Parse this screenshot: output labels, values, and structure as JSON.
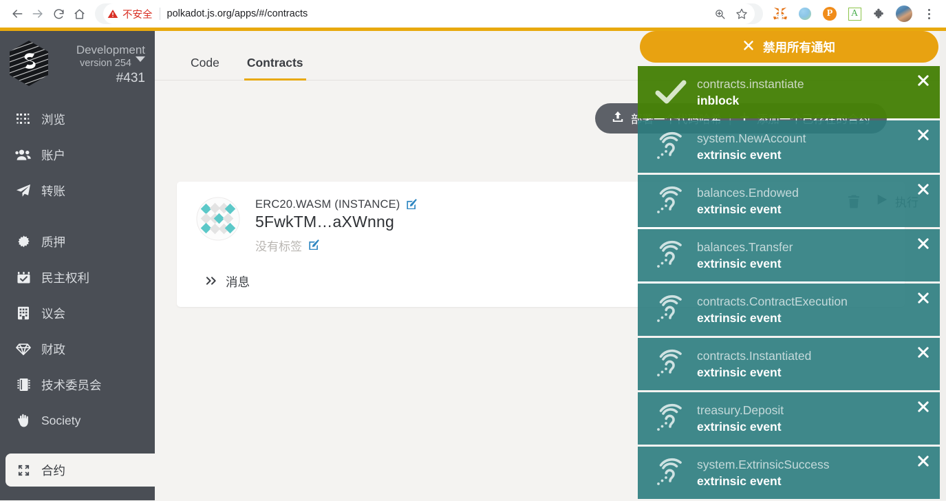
{
  "browser": {
    "back_icon": "back-arrow-icon",
    "forward_icon": "forward-arrow-icon",
    "reload_icon": "reload-icon",
    "home_icon": "home-icon",
    "security_label": "不安全",
    "url": "polkadot.js.org/apps/#/contracts",
    "zoom_icon": "zoom-icon",
    "bookmark_icon": "star-icon",
    "extensions": [
      {
        "name": "metamask-icon",
        "label": ""
      },
      {
        "name": "wallet-circle-icon",
        "label": ""
      },
      {
        "name": "polkadot-extension-icon",
        "label": "P"
      },
      {
        "name": "grammarly-icon",
        "label": "A"
      },
      {
        "name": "puzzle-extensions-icon",
        "label": ""
      },
      {
        "name": "profile-avatar",
        "label": ""
      }
    ],
    "menu_icon": "kebab-menu-icon"
  },
  "sidebar": {
    "brand": {
      "logo_icon": "substrate-hexagon-logo",
      "title": "Development",
      "version": "version 254",
      "block": "#431",
      "caret_icon": "chevron-down-icon"
    },
    "items": [
      {
        "label": "浏览",
        "icon": "grid-dots-icon",
        "active": false,
        "gap": false
      },
      {
        "label": "账户",
        "icon": "users-icon",
        "active": false,
        "gap": false
      },
      {
        "label": "转账",
        "icon": "paper-plane-icon",
        "active": false,
        "gap": false
      },
      {
        "label": "质押",
        "icon": "gear-sun-icon",
        "active": false,
        "gap": true
      },
      {
        "label": "民主权利",
        "icon": "calendar-check-icon",
        "active": false,
        "gap": false
      },
      {
        "label": "议会",
        "icon": "building-icon",
        "active": false,
        "gap": false
      },
      {
        "label": "财政",
        "icon": "gem-icon",
        "active": false,
        "gap": false
      },
      {
        "label": "技术委员会",
        "icon": "memory-chip-icon",
        "active": false,
        "gap": false
      },
      {
        "label": "Society",
        "icon": "hand-icon",
        "active": false,
        "gap": false
      },
      {
        "label": "合约",
        "icon": "expand-arrows-icon",
        "active": true,
        "gap": true
      }
    ]
  },
  "main": {
    "tabs": [
      {
        "label": "Code",
        "active": false
      },
      {
        "label": "Contracts",
        "active": true
      }
    ],
    "actions": {
      "deploy_icon": "upload-icon",
      "deploy_label": "部署一个代码哈希",
      "separator": "|",
      "add_icon": "plus-icon",
      "add_label": "添加一个已存在的合约"
    },
    "contract": {
      "identicon": "polkadot-identicon",
      "name": "ERC20.WASM (INSTANCE)",
      "name_edit_icon": "edit-pencil-icon",
      "address": "5FwkTM…aXWnng",
      "tag_placeholder": "没有标签",
      "tag_edit_icon": "edit-pencil-icon",
      "messages_chevron_icon": "double-chevron-right-icon",
      "messages_label": "消息",
      "delete_icon": "trash-icon",
      "execute_icon": "play-icon",
      "execute_label": "执行"
    }
  },
  "notifications": {
    "disable_all": {
      "close_icon": "close-x-icon",
      "label": "禁用所有通知"
    },
    "items": [
      {
        "title": "contracts.instantiate",
        "subtitle": "inblock",
        "status": "success",
        "icon": "check-mark-icon",
        "close_icon": "close-x-icon"
      },
      {
        "title": "system.NewAccount",
        "subtitle": "extrinsic event",
        "status": "event",
        "icon": "broadcast-ear-icon",
        "close_icon": "close-x-icon"
      },
      {
        "title": "balances.Endowed",
        "subtitle": "extrinsic event",
        "status": "event",
        "icon": "broadcast-ear-icon",
        "close_icon": "close-x-icon"
      },
      {
        "title": "balances.Transfer",
        "subtitle": "extrinsic event",
        "status": "event",
        "icon": "broadcast-ear-icon",
        "close_icon": "close-x-icon"
      },
      {
        "title": "contracts.ContractExecution",
        "subtitle": "extrinsic event",
        "status": "event",
        "icon": "broadcast-ear-icon",
        "close_icon": "close-x-icon"
      },
      {
        "title": "contracts.Instantiated",
        "subtitle": "extrinsic event",
        "status": "event",
        "icon": "broadcast-ear-icon",
        "close_icon": "close-x-icon"
      },
      {
        "title": "treasury.Deposit",
        "subtitle": "extrinsic event",
        "status": "event",
        "icon": "broadcast-ear-icon",
        "close_icon": "close-x-icon"
      },
      {
        "title": "system.ExtrinsicSuccess",
        "subtitle": "extrinsic event",
        "status": "event",
        "icon": "broadcast-ear-icon",
        "close_icon": "close-x-icon"
      }
    ]
  },
  "colors": {
    "accent_orange": "#e8a90e",
    "sidebar_bg": "#4a4e55",
    "page_bg": "#f4f3f1",
    "success_green": "#468108",
    "event_teal": "#2b7c7e",
    "link_blue": "#2e86c1",
    "warning_red": "#d93025"
  }
}
